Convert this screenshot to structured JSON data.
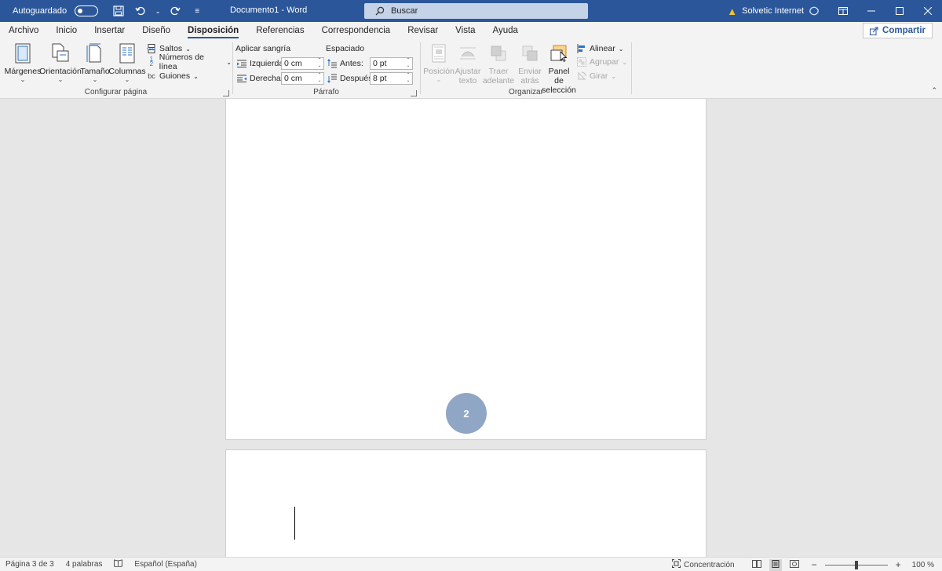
{
  "titlebar": {
    "autosave_label": "Autoguardado",
    "doc_title": "Documento1  -  Word",
    "search_placeholder": "Buscar",
    "user_name": "Solvetic Internet"
  },
  "tabs": [
    {
      "label": "Archivo"
    },
    {
      "label": "Inicio"
    },
    {
      "label": "Insertar"
    },
    {
      "label": "Diseño"
    },
    {
      "label": "Disposición",
      "active": true
    },
    {
      "label": "Referencias"
    },
    {
      "label": "Correspondencia"
    },
    {
      "label": "Revisar"
    },
    {
      "label": "Vista"
    },
    {
      "label": "Ayuda"
    }
  ],
  "share_label": "Compartir",
  "ribbon": {
    "page_setup": {
      "group_label": "Configurar página",
      "margins": "Márgenes",
      "orientation": "Orientación",
      "size": "Tamaño",
      "columns": "Columnas",
      "breaks": "Saltos",
      "line_numbers": "Números de línea",
      "hyphenation": "Guiones"
    },
    "paragraph": {
      "group_label": "Párrafo",
      "indent_heading": "Aplicar sangría",
      "left_label": "Izquierda:",
      "left_value": "0 cm",
      "right_label": "Derecha:",
      "right_value": "0 cm",
      "spacing_heading": "Espaciado",
      "before_label": "Antes:",
      "before_value": "0 pt",
      "after_label": "Después:",
      "after_value": "8 pt"
    },
    "arrange": {
      "group_label": "Organizar",
      "position_1": "Posición",
      "wrap_1": "Ajustar",
      "wrap_2": "texto",
      "forward_1": "Traer",
      "forward_2": "adelante",
      "backward_1": "Enviar",
      "backward_2": "atrás",
      "selection_1": "Panel de",
      "selection_2": "selección",
      "align": "Alinear",
      "group": "Agrupar",
      "rotate": "Girar"
    }
  },
  "document": {
    "page_number_badge": "2"
  },
  "statusbar": {
    "page": "Página 3 de 3",
    "words": "4 palabras",
    "language": "Español (España)",
    "focus": "Concentración",
    "zoom": "100 %",
    "zoom_level": 100
  },
  "colors": {
    "title_bar": "#2b579a",
    "ribbon_bg": "#f3f3f3",
    "badge": "#8fa6c5"
  }
}
